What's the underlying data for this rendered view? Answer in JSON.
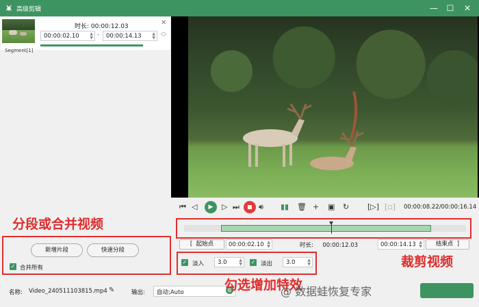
{
  "window": {
    "title": "高级剪辑",
    "minimize_label": "—",
    "maximize_label": "☐",
    "close_label": "✕"
  },
  "segment": {
    "duration_label": "时长:",
    "duration_value": "00:00:12.03",
    "start_time": "00:00:02.10",
    "end_time": "00:00:14.13",
    "name": "Segment[1]"
  },
  "player": {
    "time_readout": "00:00:08.22/00:00:16.14",
    "icons": [
      "skip-start-icon",
      "step-back-icon",
      "play-icon",
      "step-forward-icon",
      "skip-end-icon",
      "stop-icon",
      "volume-icon",
      "split-icon",
      "delete-icon",
      "add-icon",
      "copy-icon",
      "reset-icon",
      "mark-in-icon",
      "mark-out-icon"
    ]
  },
  "trim": {
    "start_point_label": "起始点",
    "start_time": "00:00:02.10",
    "duration_label": "时长:",
    "duration_value": "00:00:12.03",
    "end_time": "00:00:14.13",
    "end_point_label": "结束点",
    "selection_start_fraction": 0.1301,
    "selection_end_fraction": 0.8755,
    "playhead_fraction": 0.5212
  },
  "fade": {
    "fade_in_label": "淡入",
    "fade_in_value": "3.0",
    "fade_out_label": "淡出",
    "fade_out_value": "3.0"
  },
  "merge": {
    "new_segment_label": "新增片段",
    "quick_split_label": "快速分段",
    "merge_all_label": "合并所有"
  },
  "output": {
    "name_label": "名称:",
    "file_name": "Video_240511103815.mp4",
    "output_label": "输出:",
    "output_value": "自动;Auto"
  },
  "annotations": {
    "split_merge": "分段或合并视频",
    "crop": "裁剪视频",
    "effects": "勾选增加特效"
  },
  "watermark": "@ 数据蛙恢复专家",
  "colors": {
    "accent": "#3e9461",
    "annotation": "#e02c2c"
  }
}
